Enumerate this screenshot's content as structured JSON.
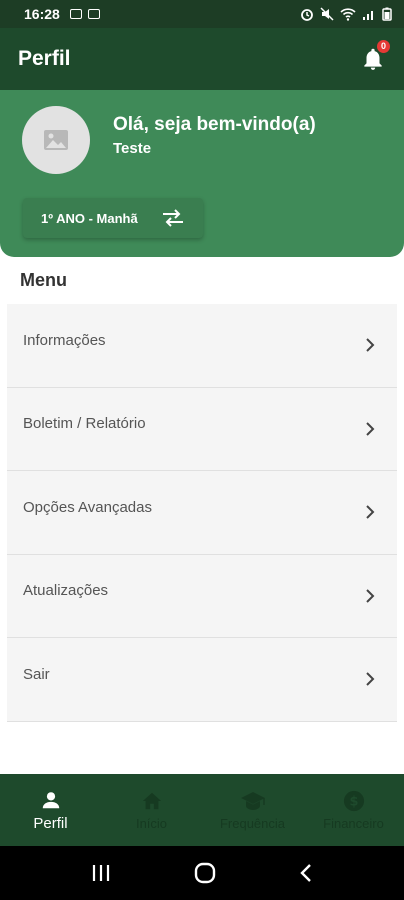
{
  "status_bar": {
    "time": "16:28",
    "icons": [
      "notification-icon",
      "photo-icon",
      "alarm-icon",
      "mute-icon",
      "wifi-icon",
      "signal-icon",
      "battery-icon"
    ]
  },
  "app_bar": {
    "title": "Perfil",
    "notification_count": "0"
  },
  "profile": {
    "greeting": "Olá, seja bem-vindo(a)",
    "username": "Teste",
    "class_label": "1º ANO - Manhã"
  },
  "menu": {
    "title": "Menu",
    "items": [
      {
        "label": "Informações"
      },
      {
        "label": "Boletim / Relatório"
      },
      {
        "label": "Opções Avançadas"
      },
      {
        "label": "Atualizações"
      },
      {
        "label": "Sair"
      }
    ]
  },
  "bottom_nav": {
    "items": [
      {
        "label": "Perfil",
        "icon": "person-icon",
        "active": true
      },
      {
        "label": "Início",
        "icon": "home-icon",
        "active": false
      },
      {
        "label": "Frequência",
        "icon": "graduation-cap-icon",
        "active": false
      },
      {
        "label": "Financeiro",
        "icon": "dollar-icon",
        "active": false
      }
    ]
  },
  "colors": {
    "app_bar": "#1e4a2c",
    "card": "#3f8a58",
    "badge": "#e53935"
  }
}
